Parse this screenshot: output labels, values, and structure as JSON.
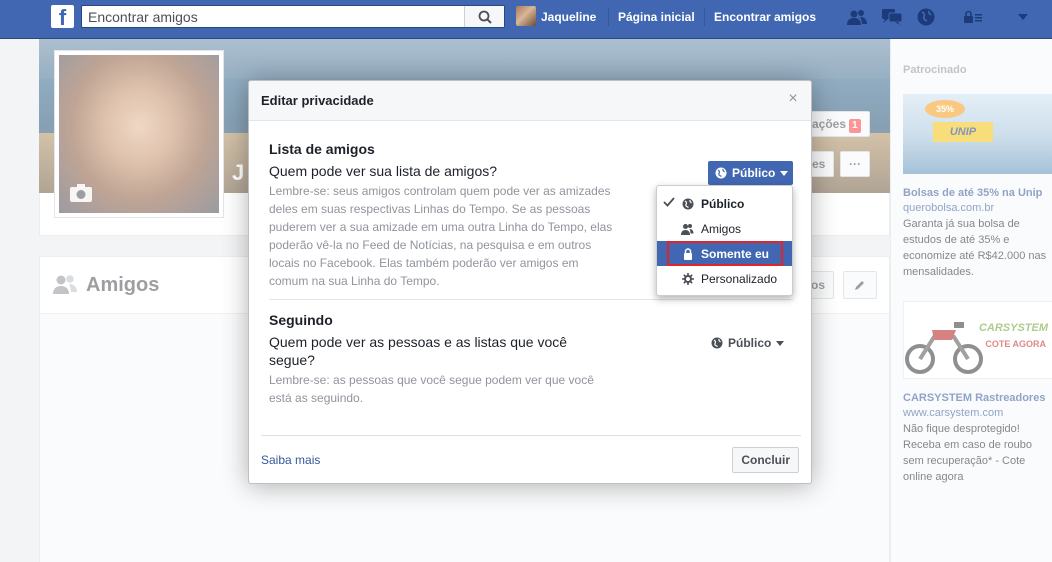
{
  "topbar": {
    "logo": "f",
    "search_placeholder": "Encontrar amigos",
    "user_name": "Jaqueline",
    "home_label": "Página inicial",
    "find_friends_label": "Encontrar amigos"
  },
  "cover": {
    "notifications_label": "ações",
    "notifications_count": "1",
    "secondary_btn_label": "es",
    "more_label": "···",
    "profile_initial": "J"
  },
  "friends_section": {
    "title": "Amigos",
    "btn_label": "os"
  },
  "sidebar": {
    "sponsored": "Patrocinado",
    "ads": [
      {
        "badge": "35%",
        "logo": "UNIP",
        "title": "Bolsas de até 35% na Unip",
        "url": "querobolsa.com.br",
        "text": "Garanta já sua bolsa de estudos de até 35% e economize até R$42.000 nas mensalidades."
      },
      {
        "logo": "CARSYSTEM",
        "tagline": "COTE AGORA",
        "title": "CARSYSTEM Rastreadores",
        "url": "www.carsystem.com",
        "text": "Não fique desprotegido! Receba em caso de roubo sem recuperação* - Cote online agora"
      }
    ]
  },
  "dialog": {
    "title": "Editar privacidade",
    "close": "×",
    "sections": [
      {
        "title": "Lista de amigos",
        "question": "Quem pode ver sua lista de amigos?",
        "hint": "Lembre-se: seus amigos controlam quem pode ver as amizades deles em suas respectivas Linhas do Tempo. Se as pessoas puderem ver a sua amizade em uma outra Linha do Tempo, elas poderão vê-la no Feed de Notícias, na pesquisa e em outros locais no Facebook. Elas também poderão ver amigos em comum na sua Linha do Tempo.",
        "privacy_value": "Público"
      },
      {
        "title": "Seguindo",
        "question": "Quem pode ver as pessoas e as listas que você segue?",
        "hint": "Lembre-se: as pessoas que você segue podem ver que você está as seguindo.",
        "privacy_value": "Público"
      }
    ],
    "menu": [
      {
        "label": "Público",
        "icon": "globe-icon",
        "checked": true
      },
      {
        "label": "Amigos",
        "icon": "friends-icon"
      },
      {
        "label": "Somente eu",
        "icon": "lock-icon",
        "selected": true
      },
      {
        "label": "Personalizado",
        "icon": "gear-icon"
      }
    ],
    "learn_more": "Saiba mais",
    "done": "Concluir"
  },
  "colors": {
    "brand": "#4267b2",
    "highlight_border": "#e0242a"
  }
}
